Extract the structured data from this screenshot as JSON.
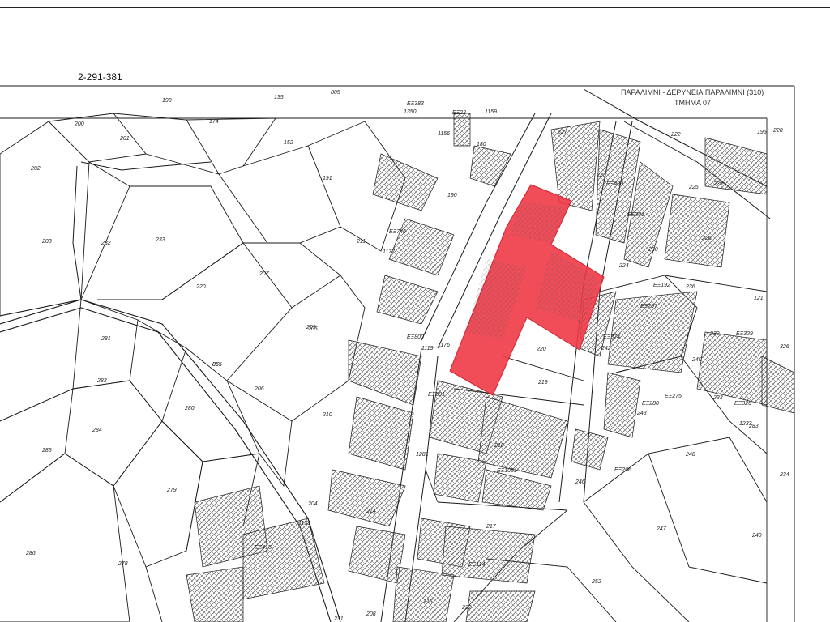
{
  "sheet": {
    "reference": "2-291-381",
    "area_title": "ΠΑΡΑΛΙΜΝΙ - ΔΕΡΥΝΕΙΑ,ΠΑΡΑΛΙΜΝΙ (310)",
    "section": "ΤΜΗΜΑ 07"
  },
  "colors": {
    "highlight": "#f03a47",
    "line": "#1a1a1a",
    "hatch": "#555555"
  },
  "parcels": [
    "198",
    "195",
    "135",
    "805",
    "200",
    "174",
    "201",
    "202",
    "152",
    "203",
    "191",
    "282",
    "233",
    "211",
    "190",
    "207",
    "220",
    "209",
    "281",
    "210",
    "283",
    "865",
    "206",
    "284",
    "280",
    "285",
    "279",
    "286",
    "278",
    "1177",
    "1119",
    "1176",
    "220",
    "219",
    "218",
    "217",
    "216",
    "1281",
    "214",
    "1131",
    "204",
    "246",
    "247",
    "248",
    "249",
    "252",
    "222",
    "223",
    "224",
    "225",
    "226",
    "227",
    "228",
    "229",
    "230",
    "236",
    "239",
    "240",
    "233",
    "242",
    "243",
    "283",
    "234",
    "231",
    "1350",
    "1156",
    "1159",
    "180",
    "205",
    "208",
    "232",
    "121",
    "326",
    "865",
    "1233"
  ],
  "labels": {
    "ez_codes": [
      "ΕΞ383",
      "ΕΞ746",
      "ΕΞ800",
      "ΕΞ501",
      "ΕΞ415",
      "ΕΞ114",
      "ΕΞ400",
      "ΕΞ301",
      "ΕΞ326",
      "ΕΞ374",
      "ΕΞ329",
      "ΕΞ192",
      "ΕΞ297",
      "ΕΞ275",
      "ΕΞ280",
      "ΕΞ266",
      "ΕΞ1051",
      "ΕΞ22"
    ]
  }
}
